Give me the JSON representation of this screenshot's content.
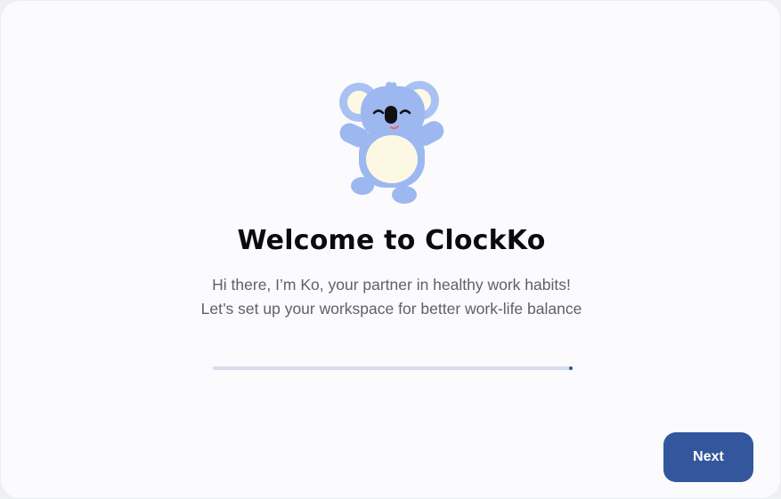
{
  "welcome": {
    "title": "Welcome to ClockKo",
    "subtitle_line1": "Hi there, I’m Ko, your partner in healthy work habits!",
    "subtitle_line2": "Let’s set up your workspace for better work-life balance"
  },
  "mascot": {
    "icon": "koala-mascot",
    "body_color": "#9db8f0",
    "belly_color": "#fdf8e4"
  },
  "progress": {
    "fraction": 1.0,
    "track_color": "#d6dceb",
    "accent_color": "#2f54a3"
  },
  "footer": {
    "next_label": "Next",
    "button_color": "#34569d"
  }
}
